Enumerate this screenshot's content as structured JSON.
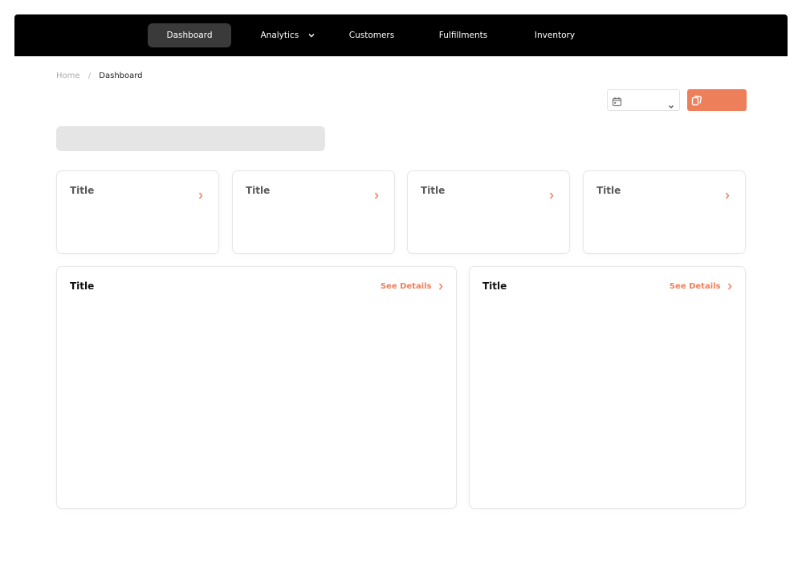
{
  "nav": {
    "items": [
      {
        "label": "Dashboard",
        "active": true
      },
      {
        "label": "Analytics",
        "has_dropdown": true
      },
      {
        "label": "Customers"
      },
      {
        "label": "Fulfillments"
      },
      {
        "label": "Inventory"
      }
    ]
  },
  "breadcrumb": {
    "home": "Home",
    "separator": "/",
    "current": "Dashboard"
  },
  "toolbar": {
    "date_select_icon": "calendar-icon",
    "date_select_value": "",
    "export_icon": "copy-icon",
    "export_label": "",
    "accent_color": "#ee7f5b"
  },
  "stat_cards": [
    {
      "title": "Title",
      "icon": "chevron-right-icon"
    },
    {
      "title": "Title",
      "icon": "chevron-right-icon"
    },
    {
      "title": "Title",
      "icon": "chevron-right-icon"
    },
    {
      "title": "Title",
      "icon": "chevron-right-icon"
    }
  ],
  "panels": [
    {
      "title": "Title",
      "link_label": "See Details"
    },
    {
      "title": "Title",
      "link_label": "See Details"
    }
  ]
}
